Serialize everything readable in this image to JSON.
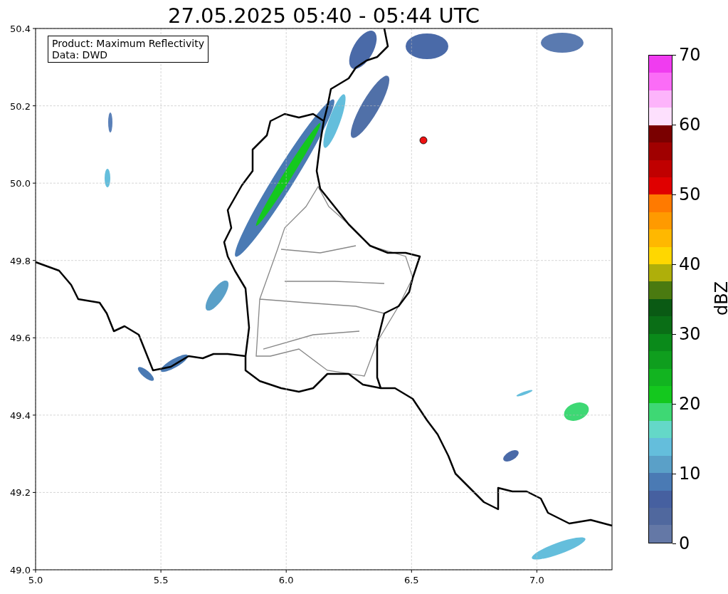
{
  "title": "27.05.2025 05:40 - 05:44 UTC",
  "axes": {
    "xticks": [
      "5.0",
      "5.5",
      "6.0",
      "6.5",
      "7.0"
    ],
    "yticks": [
      "50.4",
      "50.2",
      "50.0",
      "49.8",
      "49.6",
      "49.4",
      "49.2",
      "49.0"
    ]
  },
  "legend_lines": [
    "Product: Maximum Reflectivity",
    "Data: DWD"
  ],
  "colorbar": {
    "label": "dBZ",
    "ticks": [
      "70",
      "60",
      "50",
      "40",
      "30",
      "20",
      "10",
      "0"
    ],
    "bands": [
      {
        "color": "#f03cf0"
      },
      {
        "color": "#fb6cf7"
      },
      {
        "color": "#fdb4fb"
      },
      {
        "color": "#fde0fd"
      },
      {
        "color": "#7a0000"
      },
      {
        "color": "#a00000"
      },
      {
        "color": "#c00000"
      },
      {
        "color": "#e00000"
      },
      {
        "color": "#ff7a00"
      },
      {
        "color": "#ff9a00"
      },
      {
        "color": "#ffb800"
      },
      {
        "color": "#ffd700"
      },
      {
        "color": "#afaf0a"
      },
      {
        "color": "#4a7a10"
      },
      {
        "color": "#0a5a14"
      },
      {
        "color": "#0a6e16"
      },
      {
        "color": "#0a8a1a"
      },
      {
        "color": "#0f9e1e"
      },
      {
        "color": "#12b420"
      },
      {
        "color": "#14c81e"
      },
      {
        "color": "#3ed874"
      },
      {
        "color": "#64d8c8"
      },
      {
        "color": "#64bedc"
      },
      {
        "color": "#5aa0c8"
      },
      {
        "color": "#4a7ab4"
      },
      {
        "color": "#4660a0"
      },
      {
        "color": "#50689e"
      },
      {
        "color": "#6478a6"
      }
    ]
  }
}
